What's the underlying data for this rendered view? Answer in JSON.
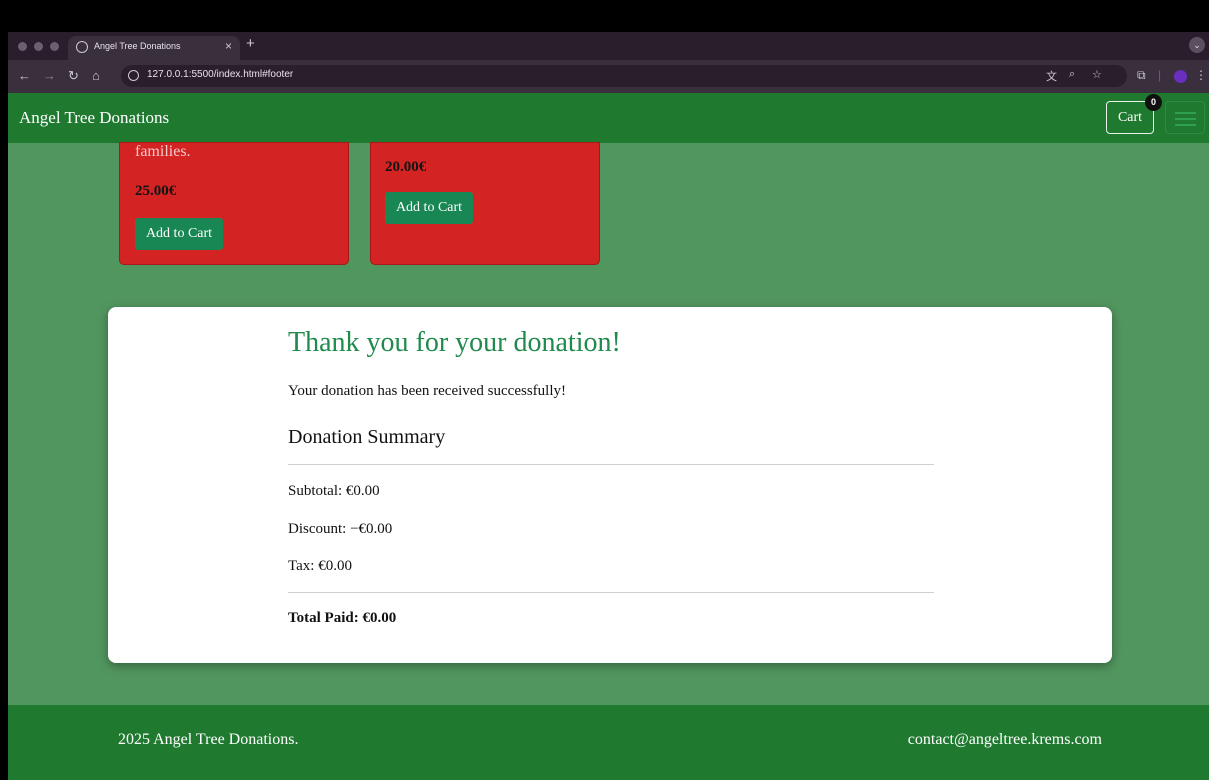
{
  "browser": {
    "tab_title": "Angel Tree Donations",
    "tab_close": "×",
    "new_tab": "+",
    "url": "127.0.0.1:5500/index.html#footer"
  },
  "navbar": {
    "brand": "Angel Tree Donations",
    "cart_label": "Cart",
    "cart_count": "0"
  },
  "products": [
    {
      "description": "families.",
      "price": "25.00€",
      "button": "Add to Cart"
    },
    {
      "price": "20.00€",
      "button": "Add to Cart"
    }
  ],
  "confirmation": {
    "heading": "Thank you for your donation!",
    "message": "Your donation has been received successfully!",
    "summary_heading": "Donation Summary",
    "subtotal": "Subtotal: €0.00",
    "discount": "Discount: −€0.00",
    "tax": "Tax: €0.00",
    "total": "Total Paid: €0.00"
  },
  "footer": {
    "copyright": "2025 Angel Tree Donations.",
    "contact": "contact@angeltree.krems.com"
  },
  "colors": {
    "navbar": "#1f7a30",
    "page_background": "#52965f",
    "card": "#d32323",
    "button": "#198754",
    "heading": "#1f8a4c"
  }
}
